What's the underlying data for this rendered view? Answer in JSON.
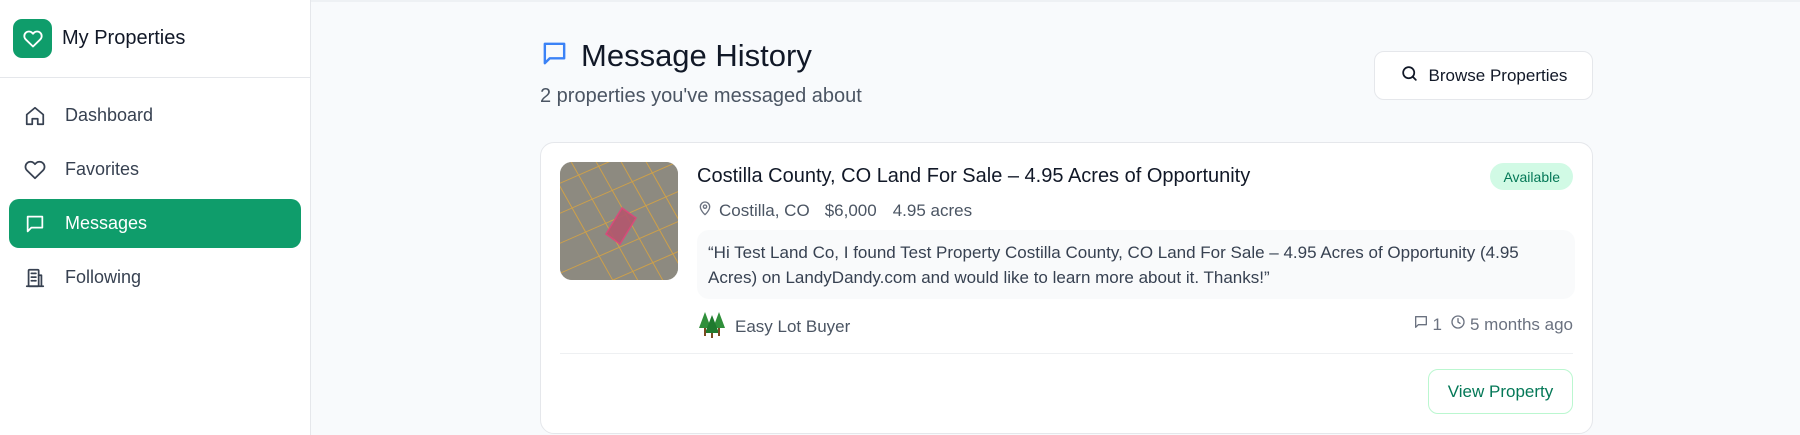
{
  "brand": {
    "title": "My Properties",
    "accent": "#0f9d6b"
  },
  "sidebar": {
    "items": [
      {
        "label": "Dashboard",
        "icon": "home-icon",
        "active": false
      },
      {
        "label": "Favorites",
        "icon": "heart-icon",
        "active": false
      },
      {
        "label": "Messages",
        "icon": "message-icon",
        "active": true
      },
      {
        "label": "Following",
        "icon": "building-icon",
        "active": false
      }
    ]
  },
  "header": {
    "title": "Message History",
    "subtitle": "2 properties you've messaged about",
    "browse_label": "Browse Properties"
  },
  "messages": [
    {
      "title": "Costilla County, CO Land For Sale – 4.95 Acres of Opportunity",
      "status": "Available",
      "location": "Costilla, CO",
      "price": "$6,000",
      "acres": "4.95 acres",
      "quote": "“Hi Test Land Co, I found Test Property Costilla County, CO Land For Sale – 4.95 Acres of Opportunity (4.95 Acres) on LandyDandy.com and would like to learn more about it. Thanks!”",
      "seller": "Easy Lot Buyer",
      "message_count": "1",
      "time_ago": "5 months ago",
      "view_label": "View Property"
    }
  ]
}
